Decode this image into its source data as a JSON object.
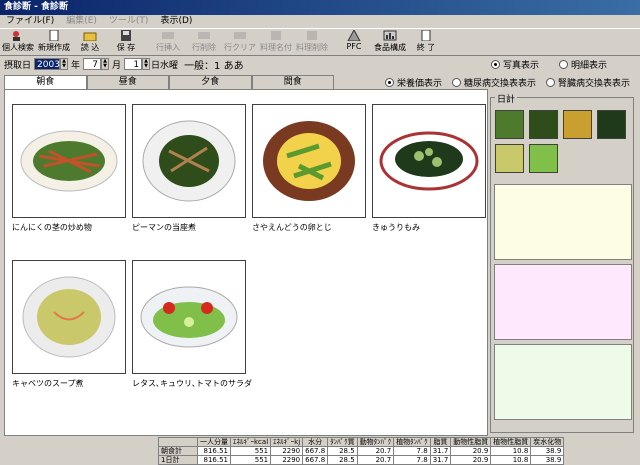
{
  "window": {
    "title": "食診断 - 食診断"
  },
  "menu": [
    {
      "label": "ファイル(F)",
      "disabled": false
    },
    {
      "label": "編集(E)",
      "disabled": true
    },
    {
      "label": "ツール(T)",
      "disabled": true
    },
    {
      "label": "表示(D)",
      "disabled": false
    }
  ],
  "toolbar": [
    {
      "label": "個人検索",
      "icon": "person-search-icon",
      "disabled": false
    },
    {
      "label": "新規作成",
      "icon": "new-doc-icon",
      "disabled": false
    },
    {
      "label": "読 込",
      "icon": "open-icon",
      "disabled": false
    },
    {
      "label": "保 存",
      "icon": "save-icon",
      "disabled": false
    },
    {
      "label": "行挿入",
      "icon": "insert-row-icon",
      "disabled": true
    },
    {
      "label": "行削除",
      "icon": "delete-row-icon",
      "disabled": true
    },
    {
      "label": "行クリア",
      "icon": "clear-row-icon",
      "disabled": true
    },
    {
      "label": "料理名付",
      "icon": "dish-name-icon",
      "disabled": true
    },
    {
      "label": "料理削除",
      "icon": "dish-delete-icon",
      "disabled": true
    },
    {
      "label": "PFC",
      "icon": "pfc-icon",
      "disabled": false
    },
    {
      "label": "食品構成",
      "icon": "food-composition-icon",
      "disabled": false
    },
    {
      "label": "終 了",
      "icon": "exit-icon",
      "disabled": false
    }
  ],
  "datebar": {
    "label": "摂取日",
    "year": "2003",
    "year_unit": "年",
    "month": "7",
    "month_unit": "月",
    "day": "1",
    "day_suffix": "日水曜",
    "person": "一般：1 ああ"
  },
  "view_options": {
    "photo": "写真表示",
    "detail": "明細表示",
    "nutrition": "栄養価表示",
    "diabetes": "糖尿病交換表表示",
    "kidney": "腎臓病交換表表示"
  },
  "tabs": [
    "朝食",
    "昼食",
    "夕食",
    "間食"
  ],
  "dishes": [
    {
      "name": "にんにくの茎の炒め物",
      "icon": "garlic-stem-stirfry-photo"
    },
    {
      "name": "ピーマンの当座煮",
      "icon": "green-pepper-simmered-photo"
    },
    {
      "name": "さやえんどうの卵とじ",
      "icon": "snow-pea-egg-photo"
    },
    {
      "name": "きゅうりもみ",
      "icon": "cucumber-salad-photo"
    },
    {
      "name": "キャベツのスープ煮",
      "icon": "cabbage-soup-photo"
    },
    {
      "name": "レタス､キュウリ､トマトのサラダ",
      "icon": "lettuce-tomato-salad-photo"
    }
  ],
  "daily": {
    "label": "日計"
  },
  "nutrition_table": {
    "headers": [
      "一人分量",
      "ｴﾈﾙｷﾞｰkcal",
      "ｴﾈﾙｷﾞｰkj",
      "水分",
      "ﾀﾝﾊﾟｸ質",
      "動物ﾀﾝﾊﾟｸ",
      "植物ﾀﾝﾊﾟｸ",
      "脂質",
      "動物性脂質",
      "植物性脂質",
      "炭水化物"
    ],
    "rows": [
      {
        "label": "朝食計",
        "values": [
          "816.51",
          "551",
          "2290",
          "667.8",
          "28.5",
          "20.7",
          "7.8",
          "31.7",
          "20.9",
          "10.8",
          "38.9"
        ]
      },
      {
        "label": "1日計",
        "values": [
          "816.51",
          "551",
          "2290",
          "667.8",
          "28.5",
          "20.7",
          "7.8",
          "31.7",
          "20.9",
          "10.8",
          "38.9"
        ]
      }
    ]
  },
  "colors": {
    "pane_yellow": "#fdfde6",
    "pane_pink": "#fde8fd",
    "pane_green": "#eefbe9"
  }
}
